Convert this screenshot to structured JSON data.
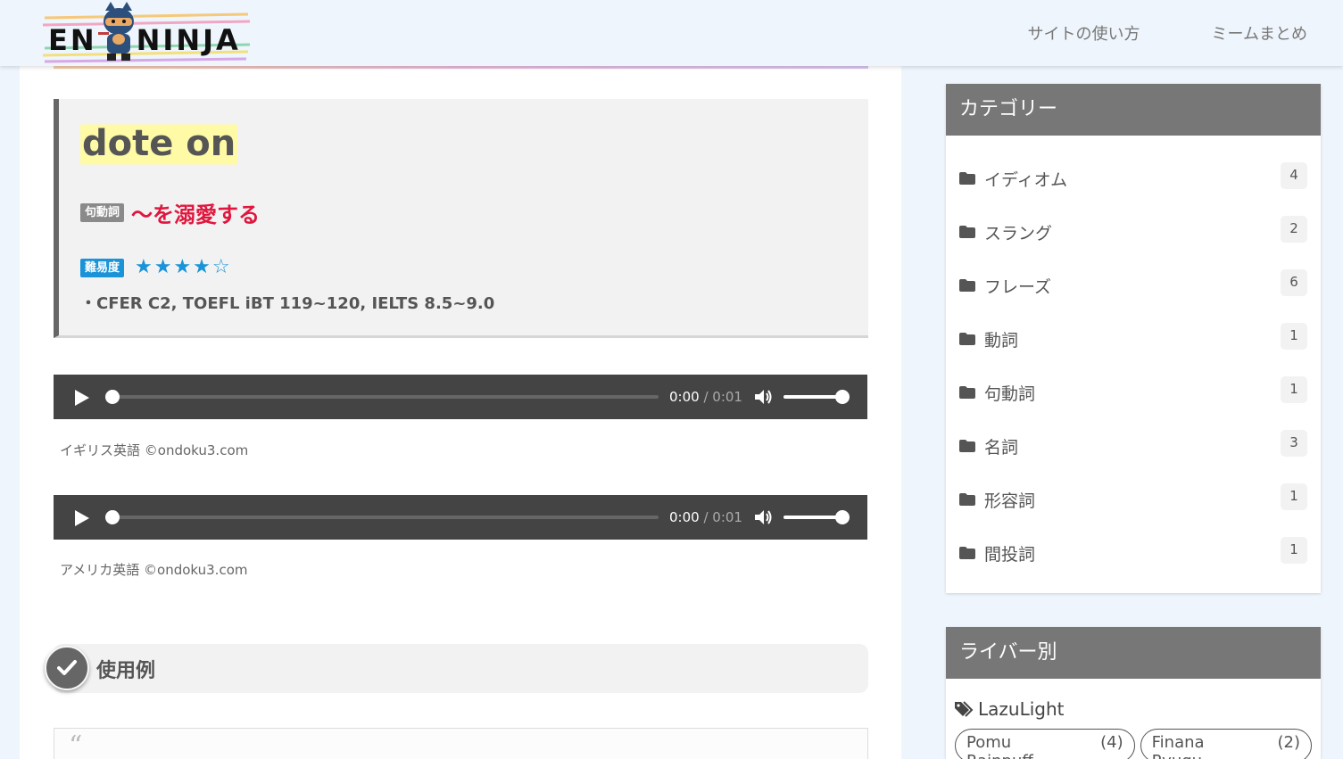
{
  "header": {
    "logo_text_left": "EN",
    "logo_text_right": "NINJA",
    "nav": [
      "サイトの使い方",
      "ミームまとめ"
    ]
  },
  "word": {
    "title": "dote on",
    "pos_badge": "句動詞",
    "meaning": "〜を溺愛する",
    "difficulty_badge": "難易度",
    "stars": "★★★★☆",
    "rating": 4,
    "rating_max": 5,
    "levels": "・CFER C2, TOEFL iBT 119~120, IELTS 8.5~9.0"
  },
  "audio": [
    {
      "time": "0:00",
      "duration": "/ 0:01",
      "caption": "イギリス英語 ©ondoku3.com"
    },
    {
      "time": "0:00",
      "duration": "/ 0:01",
      "caption": "アメリカ英語 ©ondoku3.com"
    }
  ],
  "example": {
    "title": "使用例",
    "quote_mark": "“"
  },
  "sidebar": {
    "categories_title": "カテゴリー",
    "categories": [
      {
        "label": "イディオム",
        "count": "4"
      },
      {
        "label": "スラング",
        "count": "2"
      },
      {
        "label": "フレーズ",
        "count": "6"
      },
      {
        "label": "動詞",
        "count": "1"
      },
      {
        "label": "句動詞",
        "count": "1"
      },
      {
        "label": "名詞",
        "count": "3"
      },
      {
        "label": "形容詞",
        "count": "1"
      },
      {
        "label": "間投詞",
        "count": "1"
      }
    ],
    "liver_title": "ライバー別",
    "liver_group": "LazuLight",
    "livers": [
      {
        "name": "Pomu Rainpuff",
        "count": "(4)"
      },
      {
        "name": "Finana Ryugu",
        "count": "(2)"
      }
    ]
  },
  "colors": {
    "accent_red": "#e0163e",
    "accent_blue": "#1a93d8",
    "widget_head": "#777777",
    "page_bg": "#eef5fc"
  }
}
